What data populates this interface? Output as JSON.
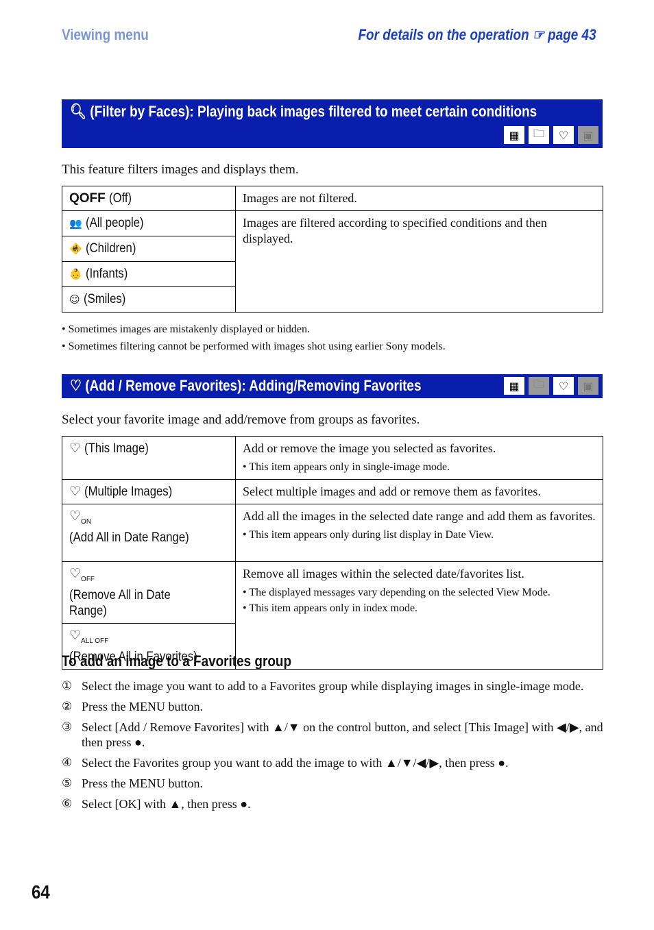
{
  "header": {
    "section": "Viewing menu",
    "details": "For details on the operation",
    "details_icon": "pointing-hand-icon",
    "page_ref": "page 43"
  },
  "filter": {
    "title": "(Filter by Faces): Playing back images filtered to meet certain conditions",
    "title_icon": "search-face-icon",
    "mode_icons": [
      {
        "name": "date-view-icon",
        "active": true
      },
      {
        "name": "folder-view-icon",
        "active": true
      },
      {
        "name": "favorites-icon",
        "active": true
      },
      {
        "name": "internal-memory-icon",
        "active": false
      }
    ],
    "intro": "This feature filters images and displays them.",
    "rows": [
      {
        "icon": "QOFF",
        "label": "(Off)"
      },
      {
        "icon": "👥",
        "label": "(All people)"
      },
      {
        "icon": "🚸",
        "label": "(Children)"
      },
      {
        "icon": "👶",
        "label": "(Infants)"
      },
      {
        "icon": "☺",
        "label": "(Smiles)"
      }
    ],
    "desc_off": "Images are not filtered.",
    "desc_on": "Images are filtered according to specified conditions and then displayed.",
    "notes": [
      "Sometimes images are mistakenly displayed or hidden.",
      "Sometimes filtering cannot be performed with images shot using earlier Sony models."
    ]
  },
  "favorites": {
    "title": "(Add / Remove Favorites): Adding/Removing Favorites",
    "mode_icons": [
      {
        "name": "date-view-icon",
        "active": true
      },
      {
        "name": "folder-view-icon",
        "active": false
      },
      {
        "name": "favorites-icon",
        "active": true
      },
      {
        "name": "internal-memory-icon",
        "active": false
      }
    ],
    "intro": "Select your favorite image and add/remove from groups as favorites.",
    "rows": [
      {
        "label": "(This Image)",
        "desc": "Add or remove the image you selected as favorites.",
        "bullets": [
          "This item appears only in single-image mode."
        ]
      },
      {
        "label": "(Multiple Images)",
        "desc": "Select multiple images and add or remove them as favorites.",
        "bullets": []
      },
      {
        "label": "(Add All in Date Range)",
        "sub": "ON",
        "desc": "Add all the images in the selected date range and add them as favorites.",
        "bullets": [
          "This item appears only during list display in Date View."
        ]
      },
      {
        "label": "(Remove All in Date Range)",
        "sub": "OFF"
      },
      {
        "label": "(Remove All in Favorites)",
        "sub": "ALL OFF"
      }
    ],
    "remove_desc": "Remove all images within the selected date/favorites list.",
    "remove_bullets": [
      "The displayed messages vary depending on the selected View Mode.",
      "This item appears only in index mode."
    ]
  },
  "howto": {
    "title": "To add an image to a Favorites group",
    "steps": [
      {
        "n": "①",
        "text": "Select the image you want to add to a Favorites group while displaying images in single-image mode."
      },
      {
        "n": "②",
        "text": "Press the MENU button."
      },
      {
        "n": "③",
        "text": "Select [Add / Remove Favorites] with ▲/▼ on the control button, and select [This Image] with ◀/▶, and then press ●."
      },
      {
        "n": "④",
        "text": "Select the Favorites group you want to add the image to with ▲/▼/◀/▶, then press ●."
      },
      {
        "n": "⑤",
        "text": "Press the MENU button."
      },
      {
        "n": "⑥",
        "text": "Select [OK] with ▲, then press ●."
      }
    ]
  },
  "page_number": "64"
}
